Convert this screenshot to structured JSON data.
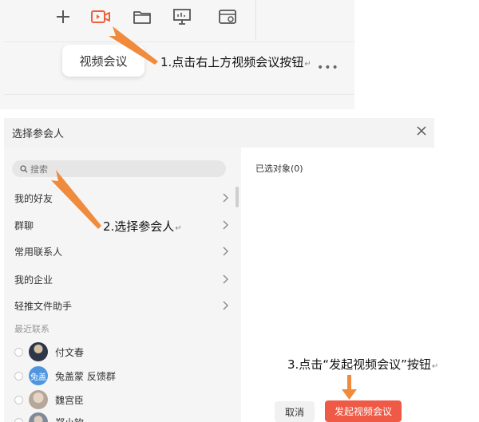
{
  "toolbar": {
    "icons": [
      "plus-icon",
      "video-camera-icon",
      "folder-icon",
      "presentation-icon",
      "calendar-icon"
    ],
    "tooltip_label": "视频会议",
    "more": "•••",
    "accent_color": "#f0603a"
  },
  "annotations": {
    "step1": "1.点击右上方视频会议按钮",
    "step2": "2.选择参会人",
    "step3": "3.点击“发起视频会议”按钮",
    "mark": "↵",
    "arrow_color": "#f08a3c"
  },
  "dialog": {
    "title": "选择参会人",
    "search_placeholder": "搜索",
    "nav_items": [
      "我的好友",
      "群聊",
      "常用联系人",
      "我的企业",
      "轻推文件助手"
    ],
    "recent_label": "最近联系",
    "contacts": [
      {
        "name": "付文春",
        "avatar_text": ""
      },
      {
        "name": "兔盖蒙 反馈群",
        "avatar_text": "兔盖"
      },
      {
        "name": "魏宫臣",
        "avatar_text": ""
      },
      {
        "name": "郑小钦",
        "avatar_text": ""
      }
    ],
    "selected_label": "已选对象(0)",
    "cancel_label": "取消",
    "start_label": "发起视频会议",
    "start_color": "#ef5a46"
  }
}
